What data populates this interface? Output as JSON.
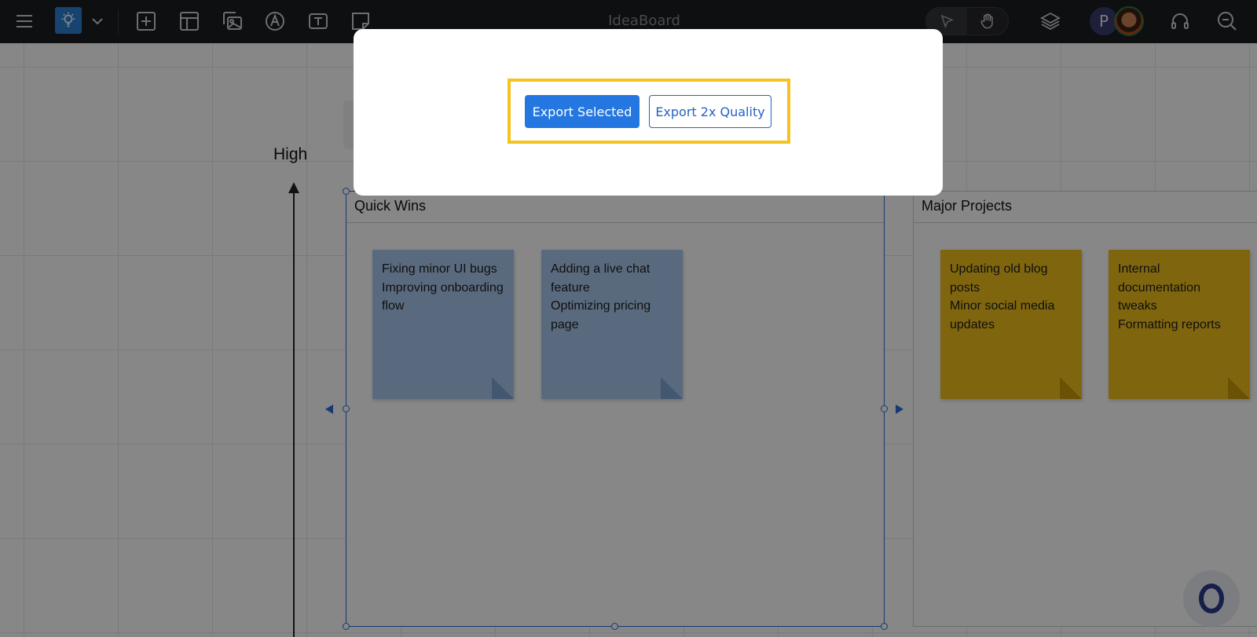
{
  "toolbar": {
    "title": "IdeaBoard",
    "icons": [
      "menu-icon",
      "lightbulb-icon",
      "chevron-down-icon",
      "add-icon",
      "template-icon",
      "image-icon",
      "pen-icon",
      "text-icon",
      "sticky-note-icon",
      "select-pointer-icon",
      "hand-icon",
      "layers-icon",
      "headset-icon",
      "zoom-out-icon"
    ],
    "avatar_initial": "P",
    "accent": "#2a7fd4"
  },
  "board": {
    "axis_label": "High",
    "quadrants": [
      {
        "title": "Quick Wins",
        "notes": [
          {
            "color": "blue",
            "lines": [
              "Fixing minor UI bugs",
              "Improving onboarding flow"
            ]
          },
          {
            "color": "blue",
            "lines": [
              "Adding a live chat feature",
              "Optimizing pricing page"
            ]
          }
        ]
      },
      {
        "title": "Major Projects",
        "notes": [
          {
            "color": "yellow",
            "lines": [
              "Updating old blog posts",
              "Minor social media updates"
            ]
          },
          {
            "color": "yellow",
            "lines": [
              "Internal documentation tweaks",
              "Formatting reports"
            ]
          }
        ]
      }
    ]
  },
  "modal": {
    "export_selected_label": "Export Selected",
    "export_2x_label": "Export 2x Quality",
    "highlight_color": "#f6c21e",
    "primary_color": "#2476e0"
  }
}
